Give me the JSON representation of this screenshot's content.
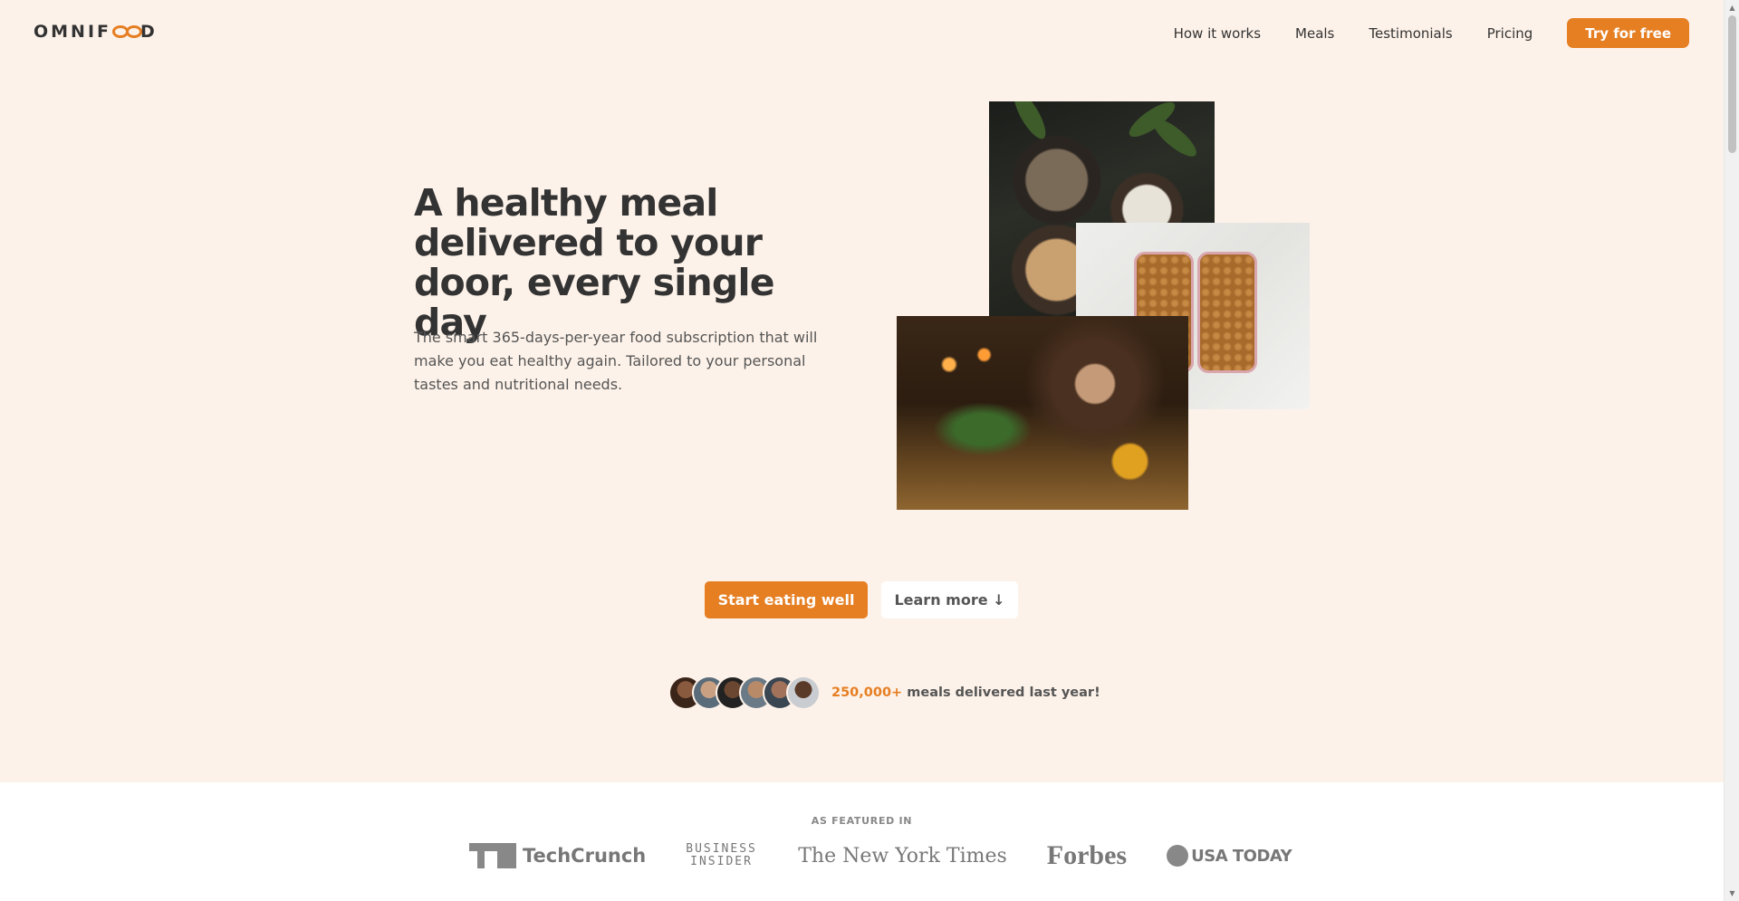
{
  "header": {
    "logo_text": "OMNIFOOD",
    "nav": [
      {
        "label": "How it works"
      },
      {
        "label": "Meals"
      },
      {
        "label": "Testimonials"
      },
      {
        "label": "Pricing"
      }
    ],
    "cta_label": "Try for free"
  },
  "hero": {
    "title": "A healthy meal delivered to your door, every single day",
    "description": "The smart 365-days-per-year food subscription that will make you eat healthy again. Tailored to your personal tastes and nutritional needs.",
    "primary_button": "Start eating well",
    "secondary_button": "Learn more ↓",
    "delivered_number": "250,000+",
    "delivered_text": " meals delivered last year!"
  },
  "featured": {
    "heading": "AS FEATURED IN",
    "logos": [
      "TechCrunch",
      "BUSINESS INSIDER",
      "The New York Times",
      "Forbes",
      "USA TODAY"
    ]
  },
  "colors": {
    "accent": "#e67e22",
    "hero_background": "#fdf2e9",
    "text_dark": "#333333"
  }
}
